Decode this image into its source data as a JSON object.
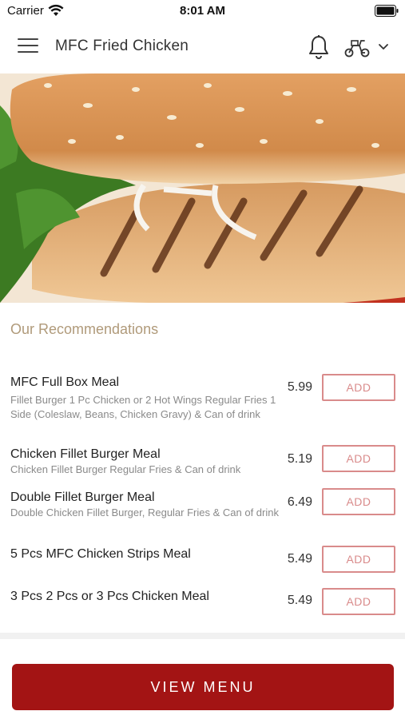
{
  "status_bar": {
    "carrier": "Carrier",
    "time": "8:01 AM"
  },
  "header": {
    "title": "MFC Fried Chicken",
    "icons": [
      "menu-icon",
      "bell-icon",
      "scooter-icon",
      "chevron-down-icon"
    ]
  },
  "hero": {
    "image": "chicken-fillet-burger-photo"
  },
  "recommendations": {
    "title": "Our Recommendations",
    "items": [
      {
        "name": "MFC Full Box Meal",
        "description": "Fillet Burger   1 Pc Chicken or 2 Hot Wings   Regular Fries   1 Side (Coleslaw, Beans, Chicken Gravy)   & Can of drink",
        "price": "5.99",
        "add_label": "ADD"
      },
      {
        "name": "Chicken Fillet Burger Meal",
        "description": "Chicken Fillet Burger   Regular Fries &   Can of drink",
        "price": "5.19",
        "add_label": "ADD"
      },
      {
        "name": "Double Fillet Burger Meal",
        "description": "Double Chicken Fillet   Burger, Regular Fries &   Can of drink",
        "price": "6.49",
        "add_label": "ADD"
      },
      {
        "name": "5 Pcs MFC Chicken Strips Meal",
        "description": "",
        "price": "5.49",
        "add_label": "ADD"
      },
      {
        "name": "3 Pcs 2 Pcs or 3 Pcs Chicken Meal",
        "description": "",
        "price": "5.49",
        "add_label": "ADD"
      }
    ]
  },
  "view_menu_label": "VIEW MENU",
  "colors": {
    "accent": "#a31414",
    "add_border": "#d98b8b",
    "section_title": "#b09a7a"
  }
}
